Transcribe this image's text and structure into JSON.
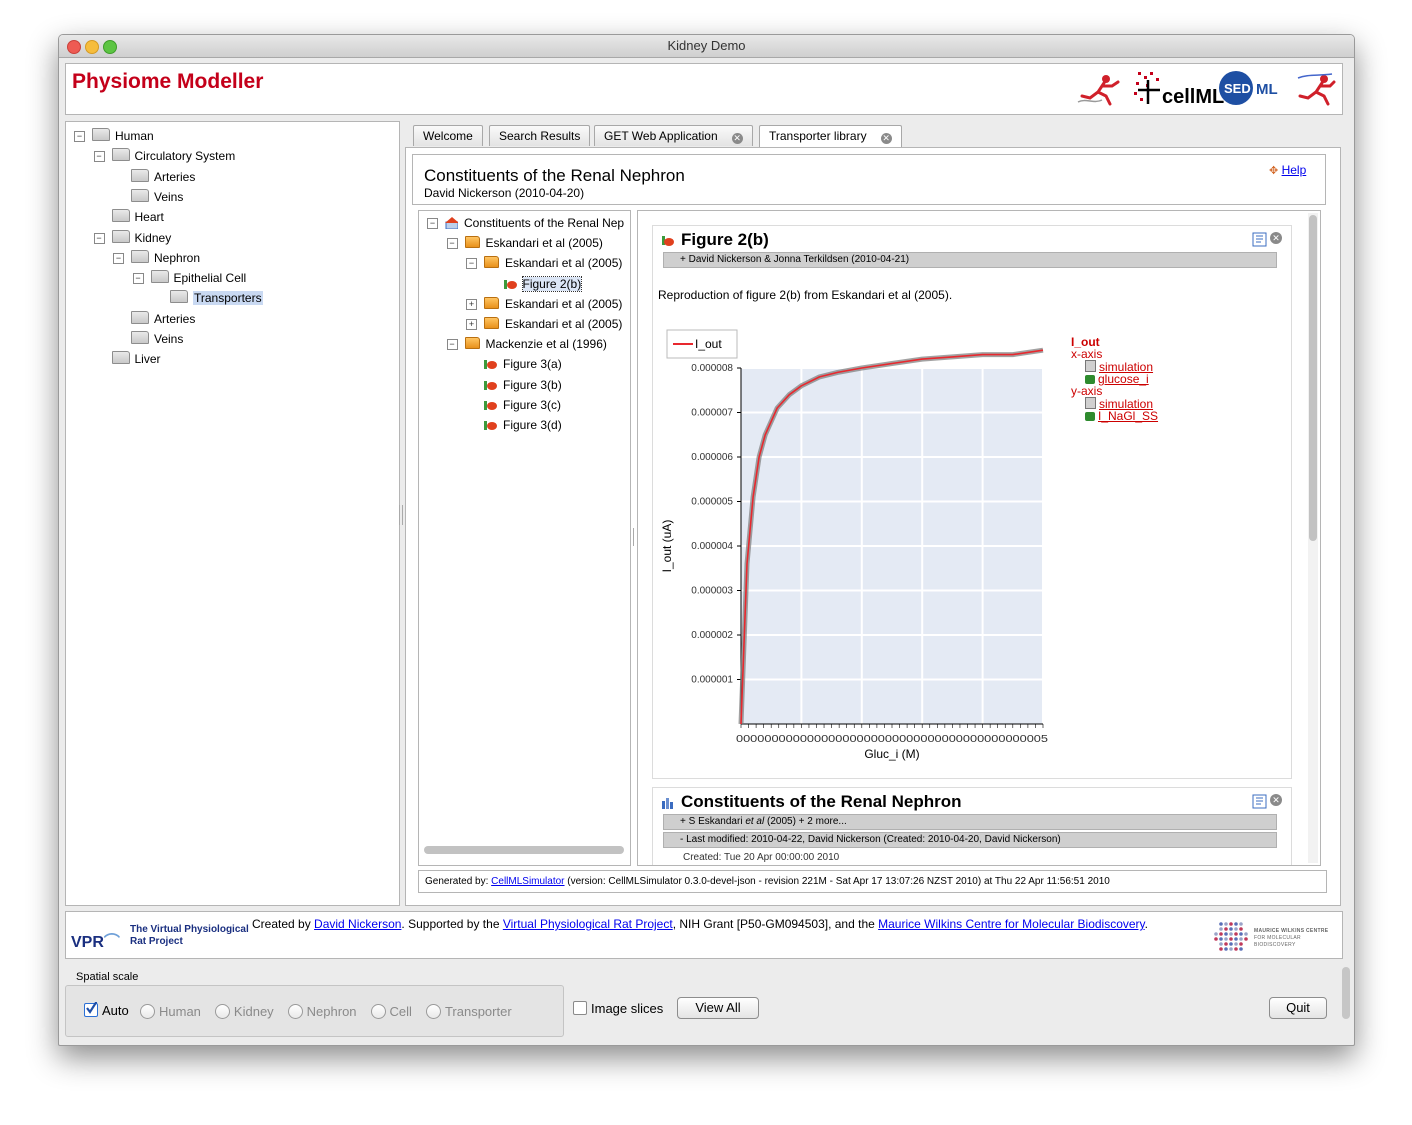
{
  "window": {
    "title": "Kidney Demo"
  },
  "header": {
    "app_title": "Physiome Modeller",
    "logos": [
      "physiome-runner-icon",
      "cellml-logo",
      "sedml-logo",
      "physiome-runner-icon"
    ],
    "cellml_text": "cellML",
    "sed_text": "SED",
    "ml_text": "ML"
  },
  "left_tree": [
    {
      "label": "Human",
      "level": 0,
      "toggle": "−"
    },
    {
      "label": "Circulatory System",
      "level": 1,
      "toggle": "−"
    },
    {
      "label": "Arteries",
      "level": 2
    },
    {
      "label": "Veins",
      "level": 2
    },
    {
      "label": "Heart",
      "level": 1
    },
    {
      "label": "Kidney",
      "level": 1,
      "toggle": "−"
    },
    {
      "label": "Nephron",
      "level": 2,
      "toggle": "−"
    },
    {
      "label": "Epithelial Cell",
      "level": 3,
      "toggle": "−"
    },
    {
      "label": "Transporters",
      "level": 4,
      "selected": true
    },
    {
      "label": "Arteries",
      "level": 2
    },
    {
      "label": "Veins",
      "level": 2
    },
    {
      "label": "Liver",
      "level": 1
    }
  ],
  "tabs": [
    {
      "label": "Welcome",
      "closable": false
    },
    {
      "label": "Search Results",
      "closable": false
    },
    {
      "label": "GET Web Application",
      "closable": true
    },
    {
      "label": "Transporter library",
      "closable": true,
      "active": true
    }
  ],
  "page": {
    "title": "Constituents of the Renal Nephron",
    "subtitle": "David Nickerson (2010-04-20)",
    "help": "Help"
  },
  "inner_tree": [
    {
      "label": "Constituents of the Renal Nep",
      "level": 0,
      "toggle": "−",
      "icon": "model"
    },
    {
      "label": "Eskandari et al (2005)",
      "level": 1,
      "toggle": "−",
      "icon": "open-folder"
    },
    {
      "label": "Eskandari et al (2005)",
      "level": 2,
      "toggle": "−",
      "icon": "open-folder"
    },
    {
      "label": "Figure 2(b)",
      "level": 3,
      "icon": "figure",
      "selected": true
    },
    {
      "label": "Eskandari et al (2005)",
      "level": 2,
      "toggle": "+",
      "icon": "folder"
    },
    {
      "label": "Eskandari et al (2005)",
      "level": 2,
      "toggle": "+",
      "icon": "folder"
    },
    {
      "label": "Mackenzie et al (1996)",
      "level": 1,
      "toggle": "−",
      "icon": "open-folder"
    },
    {
      "label": "Figure 3(a)",
      "level": 2,
      "icon": "figure"
    },
    {
      "label": "Figure 3(b)",
      "level": 2,
      "icon": "figure"
    },
    {
      "label": "Figure 3(c)",
      "level": 2,
      "icon": "figure"
    },
    {
      "label": "Figure 3(d)",
      "level": 2,
      "icon": "figure"
    }
  ],
  "figure": {
    "heading": "Figure 2(b)",
    "authors": "+ David Nickerson & Jonna Terkildsen (2010-04-21)",
    "description": "Reproduction of figure 2(b) from Eskandari et al (2005).",
    "side": {
      "var": "I_out",
      "xaxis": "x-axis",
      "x_sim": "simulation",
      "x_var": "glucose_i",
      "yaxis": "y-axis",
      "y_sim": "simulation",
      "y_var": "I_NaGl_SS"
    }
  },
  "chart_data": {
    "type": "line",
    "xlabel": "Gluc_i (M)",
    "ylabel": "I_out (uA)",
    "legend": "top-left",
    "grid": true,
    "ylim": [
      0,
      8e-06
    ],
    "yticks": [
      "0.000001",
      "0.000002",
      "0.000003",
      "0.000004",
      "0.000005",
      "0.000006",
      "0.000007",
      "0.000008"
    ],
    "xtick_text": "00000000000000000000000000000000000000000005",
    "series": [
      {
        "name": "I_out",
        "color": "#e8282e",
        "x": [
          0,
          0.1,
          0.2,
          0.3,
          0.4,
          0.6,
          0.8,
          1.0,
          1.3,
          1.6,
          2.0,
          2.5,
          3.0,
          3.5,
          4.0,
          4.5,
          5.0
        ],
        "y": [
          0,
          3.6e-06,
          5.1e-06,
          6e-06,
          6.5e-06,
          7.1e-06,
          7.4e-06,
          7.6e-06,
          7.8e-06,
          7.9e-06,
          8e-06,
          8.1e-06,
          8.2e-06,
          8.25e-06,
          8.3e-06,
          8.3e-06,
          8.4e-06
        ]
      }
    ]
  },
  "model": {
    "heading": "Constituents of the Renal Nephron",
    "authors_prefix": "+ S Eskandari ",
    "authors_etal": "et al",
    "authors_suffix": " (2005) + 2 more...",
    "modified": "- Last modified: 2010-04-22, David Nickerson (Created: 2010-04-20, David Nickerson)",
    "created_cut": "Created: Tue 20 Apr 00:00:00 2010"
  },
  "generated": {
    "prefix": "Generated by: ",
    "link": "CellMLSimulator",
    "suffix": " (version: CellMLSimulator 0.3.0-devel-json - revision 221M - Sat Apr 17 13:07:26 NZST 2010) at Thu 22 Apr 11:56:51 2010"
  },
  "footer": {
    "vpr": "VPR",
    "vpr_name_1": "The Virtual Physiological",
    "vpr_name_2": "Rat Project",
    "p1": "Created by ",
    "l1": "David Nickerson",
    "p2": ". Supported by the ",
    "l2": "Virtual Physiological Rat Project",
    "p3": ", NIH Grant [P50-GM094503], and the ",
    "l3": "Maurice Wilkins Centre for Molecular Biodiscovery",
    "p4": ".",
    "mwc_1": "MAURICE WILKINS CENTRE",
    "mwc_2": "FOR MOLECULAR BIODISCOVERY"
  },
  "controls": {
    "group_label": "Spatial scale",
    "auto": "Auto",
    "radios": [
      "Human",
      "Kidney",
      "Nephron",
      "Cell",
      "Transporter"
    ],
    "image_slices": "Image slices",
    "view_all": "View All",
    "quit": "Quit"
  }
}
